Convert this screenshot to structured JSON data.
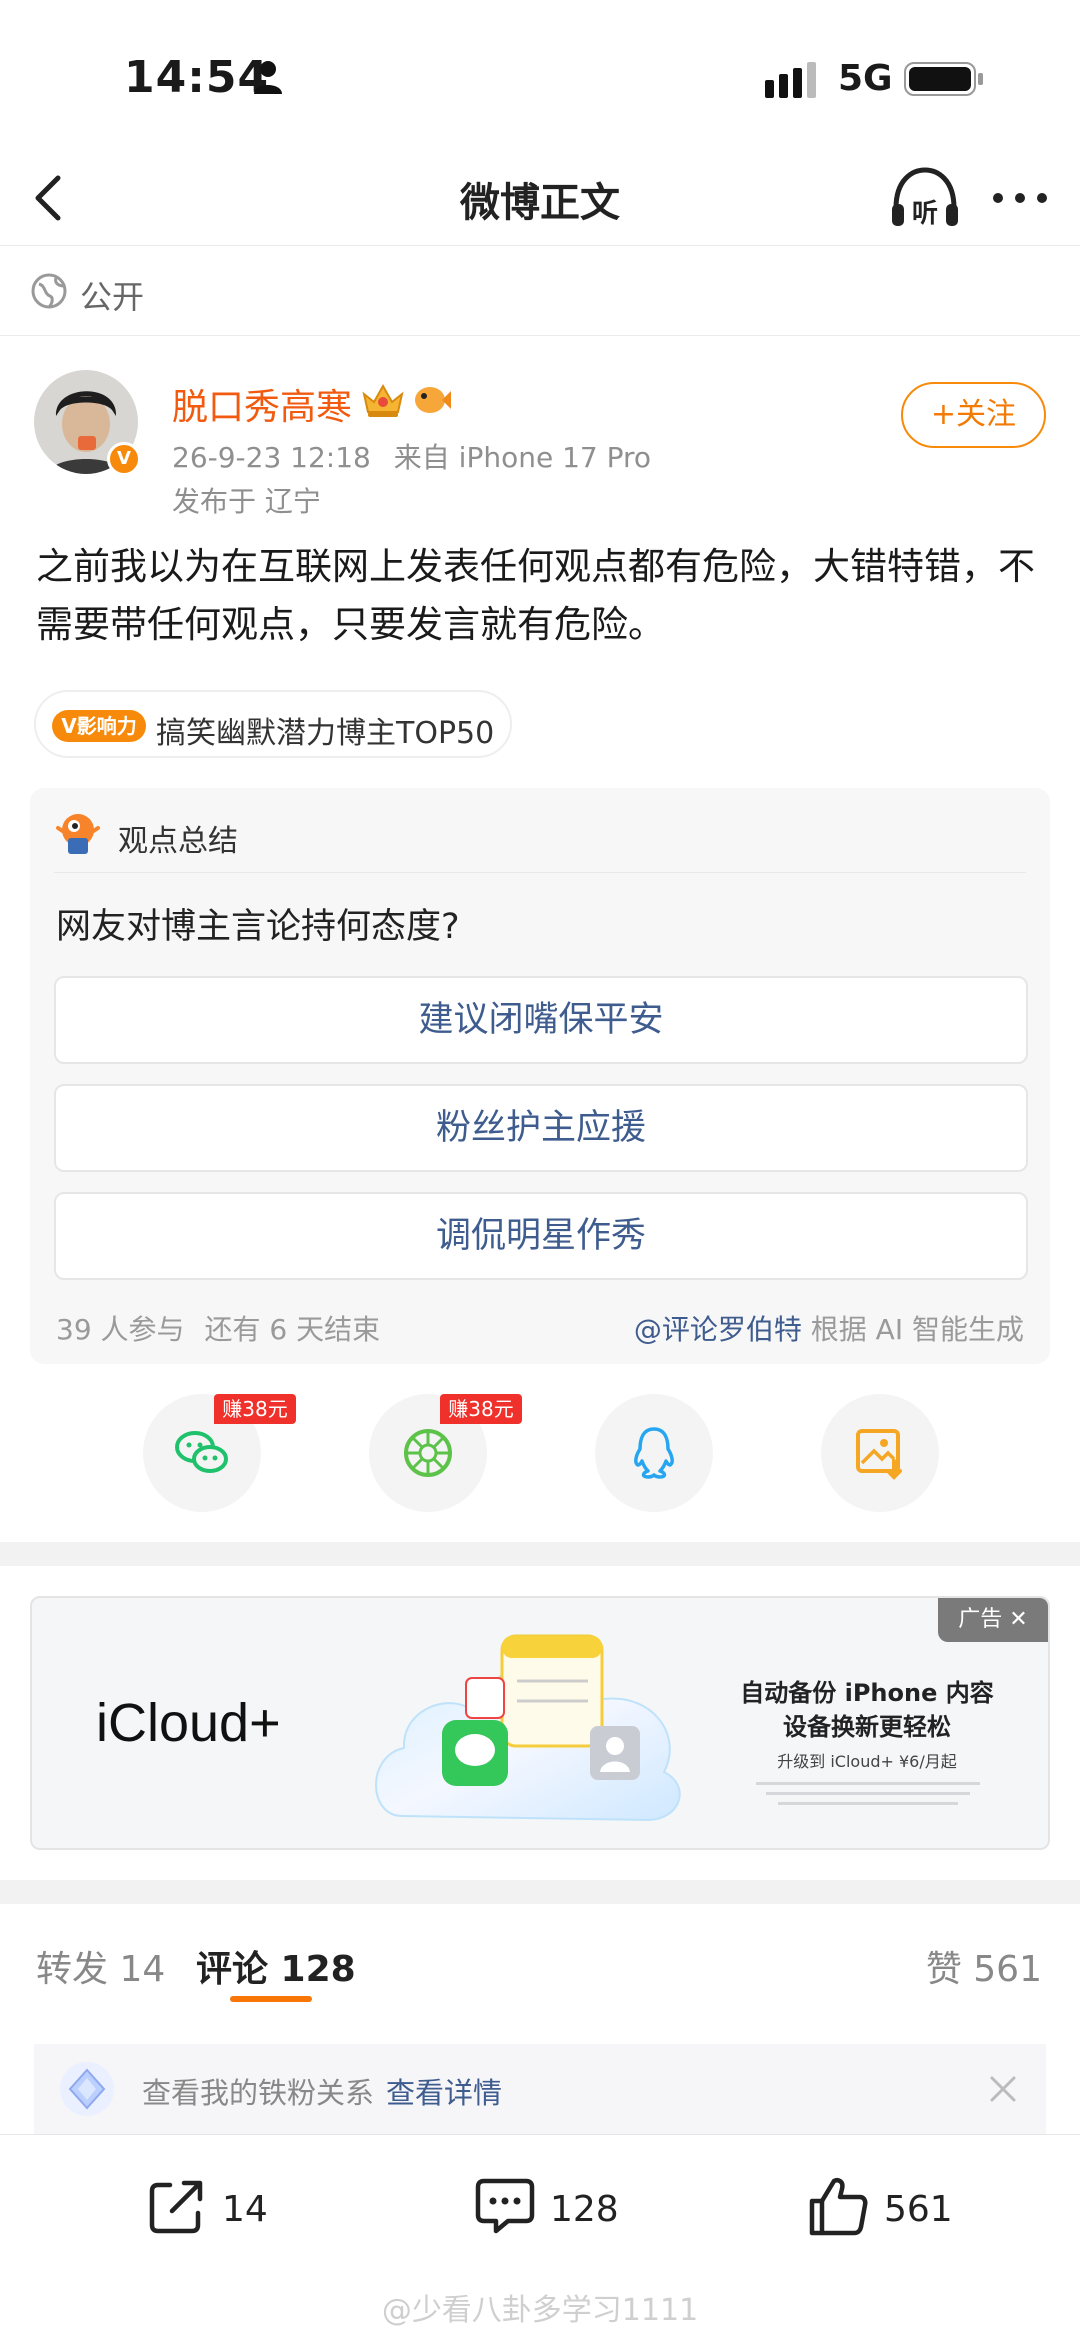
{
  "status_bar": {
    "time": "14:54",
    "network": "5G"
  },
  "nav": {
    "title": "微博正文",
    "listen_label": "听"
  },
  "visibility": {
    "label": "公开"
  },
  "author": {
    "name": "脱口秀高寒",
    "badge": "V",
    "timestamp": "26-9-23 12:18",
    "source": "来自 iPhone 17 Pro",
    "location": "发布于 辽宁",
    "follow_label": "+关注"
  },
  "post": {
    "text": "之前我以为在互联网上发表任何观点都有危险，大错特错，不需要带任何观点，只要发言就有危险。"
  },
  "influence_tag": {
    "badge": "V影响力",
    "text": "搞笑幽默潜力博主TOP50"
  },
  "summary": {
    "label": "观点总结",
    "question": "网友对博主言论持何态度?",
    "options": [
      "建议闭嘴保平安",
      "粉丝护主应援",
      "调侃明星作秀"
    ],
    "participants": "39 人参与",
    "ends": "还有 6 天结束",
    "ai_link": "@评论罗伯特",
    "ai_note": "根据 AI 智能生成"
  },
  "share": {
    "earn_label": "赚38元",
    "items": [
      "wechat-icon",
      "moments-icon",
      "qq-icon",
      "save-image-icon"
    ]
  },
  "ad": {
    "tag": "广告 ✕",
    "brand": "iCloud+",
    "headline": "自动备份 iPhone 内容\n设备换新更轻松",
    "sub": "升级到 iCloud+ ¥6/月起"
  },
  "tabs": {
    "repost": "转发 14",
    "comment": "评论 128",
    "likes": "赞 561"
  },
  "fan_banner": {
    "text": "查看我的铁粉关系",
    "link": "查看详情"
  },
  "bottom_bar": {
    "reposts": "14",
    "comments": "128",
    "likes": "561"
  },
  "watermark": "@少看八卦多学习1111",
  "colors": {
    "accent": "#f78a0a",
    "link": "#3f5c8e",
    "name": "#f15a0f",
    "earn": "#f0302a"
  }
}
